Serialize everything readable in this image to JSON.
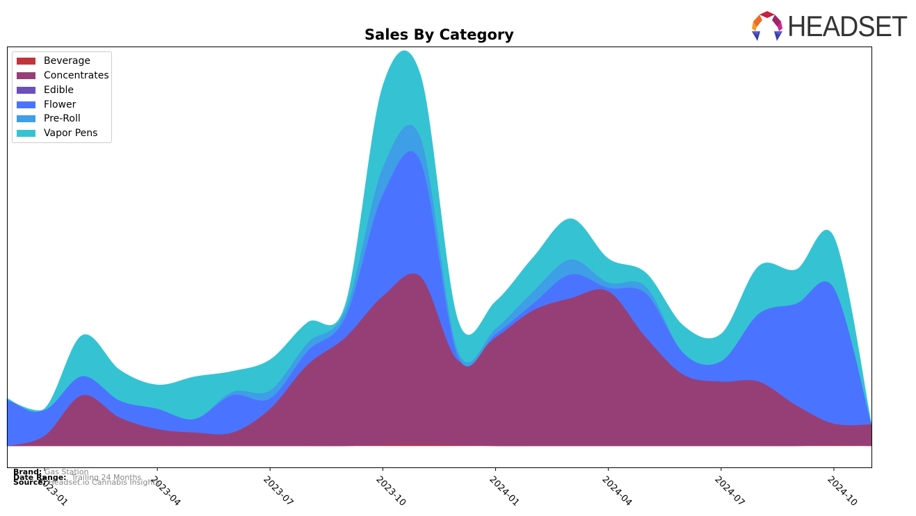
{
  "chart_data": {
    "type": "area",
    "stacked": true,
    "smoothed": true,
    "title": "Sales By Category",
    "xlabel": "",
    "ylabel": "",
    "y_tick_labels_visible": false,
    "x": [
      "2022-12",
      "2023-01",
      "2023-02",
      "2023-03",
      "2023-04",
      "2023-05",
      "2023-06",
      "2023-07",
      "2023-08",
      "2023-09",
      "2023-10",
      "2023-11",
      "2023-12",
      "2024-01",
      "2024-02",
      "2024-03",
      "2024-04",
      "2024-05",
      "2024-06",
      "2024-07",
      "2024-08",
      "2024-09",
      "2024-10",
      "2024-11"
    ],
    "x_tick_labels": [
      "2023-01",
      "2023-04",
      "2023-07",
      "2023-10",
      "2024-01",
      "2024-04",
      "2024-07",
      "2024-10"
    ],
    "ylim": [
      0,
      560
    ],
    "legend_position": "top-left",
    "series": [
      {
        "name": "Beverage",
        "color": "#c1343b",
        "values": [
          0,
          0,
          0,
          0,
          0,
          0,
          0,
          0,
          0,
          0,
          1,
          2,
          1,
          0,
          0,
          0,
          0,
          0,
          0,
          0,
          0,
          0,
          1,
          0
        ]
      },
      {
        "name": "Concentrates",
        "color": "#963f77",
        "values": [
          0,
          15,
          75,
          42,
          25,
          20,
          20,
          55,
          120,
          160,
          220,
          248,
          125,
          160,
          200,
          218,
          228,
          160,
          105,
          95,
          95,
          60,
          32,
          32
        ]
      },
      {
        "name": "Edible",
        "color": "#6b4fbf",
        "values": [
          0,
          0,
          0,
          0,
          0,
          0,
          0,
          0,
          0,
          0,
          0,
          0,
          0,
          0,
          0,
          0,
          0,
          0,
          0,
          0,
          0,
          0,
          0,
          0
        ]
      },
      {
        "name": "Flower",
        "color": "#4a74ff",
        "values": [
          68,
          38,
          28,
          25,
          30,
          20,
          55,
          15,
          20,
          30,
          150,
          170,
          6,
          5,
          10,
          35,
          5,
          65,
          32,
          30,
          100,
          150,
          200,
          0
        ]
      },
      {
        "name": "Pre-Roll",
        "color": "#3e9ee6",
        "values": [
          0,
          0,
          0,
          0,
          0,
          0,
          5,
          12,
          12,
          10,
          40,
          35,
          8,
          8,
          18,
          22,
          8,
          10,
          0,
          0,
          0,
          0,
          0,
          0
        ]
      },
      {
        "name": "Vapor Pens",
        "color": "#35c3d3",
        "values": [
          2,
          2,
          60,
          45,
          35,
          62,
          30,
          45,
          30,
          8,
          120,
          92,
          45,
          40,
          50,
          60,
          35,
          20,
          40,
          40,
          70,
          50,
          75,
          0
        ]
      }
    ]
  },
  "legend": {
    "items": [
      {
        "label": "Beverage",
        "color": "#c1343b"
      },
      {
        "label": "Concentrates",
        "color": "#963f77"
      },
      {
        "label": "Edible",
        "color": "#6b4fbf"
      },
      {
        "label": "Flower",
        "color": "#4a74ff"
      },
      {
        "label": "Pre-Roll",
        "color": "#3e9ee6"
      },
      {
        "label": "Vapor Pens",
        "color": "#35c3d3"
      }
    ]
  },
  "logo": {
    "text": "HEADSET"
  },
  "footer": {
    "brand_label": "Brand:",
    "brand_value": "Gas Station",
    "date_label": "Date Range:",
    "date_value": "Trailing 24 Months",
    "source_label": "Source:",
    "source_value": "Headset.io Cannabis Insights"
  }
}
